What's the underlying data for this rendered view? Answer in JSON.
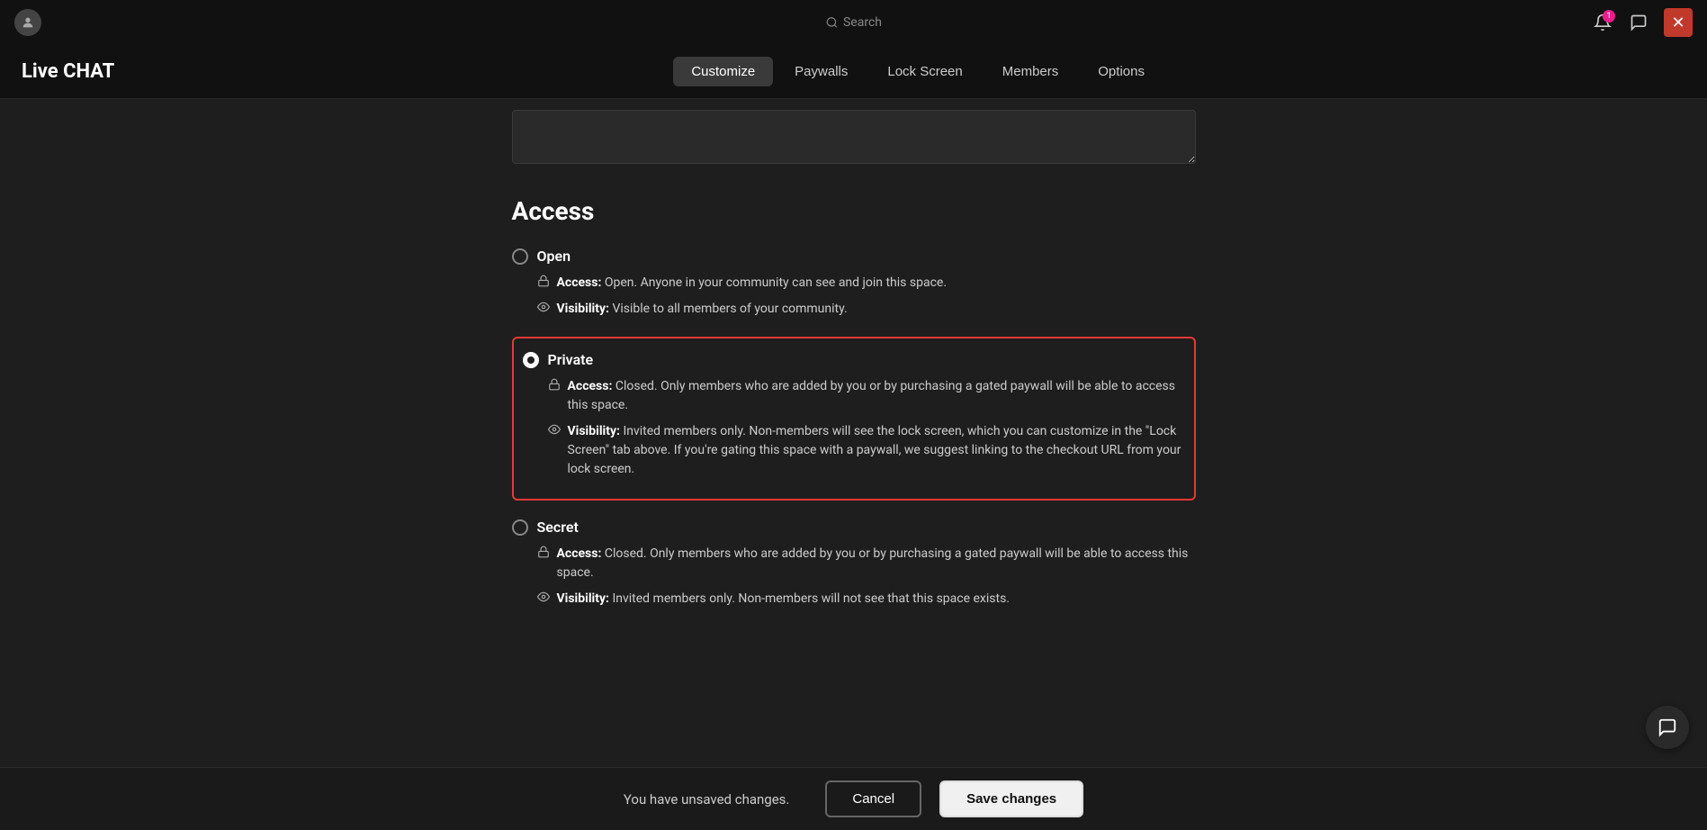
{
  "topbar": {
    "search_placeholder": "Search",
    "notification_count": "1"
  },
  "nav": {
    "brand": "Live CHAT",
    "tabs": [
      {
        "label": "Customize",
        "active": true
      },
      {
        "label": "Paywalls",
        "active": false
      },
      {
        "label": "Lock Screen",
        "active": false
      },
      {
        "label": "Members",
        "active": false
      },
      {
        "label": "Options",
        "active": false
      }
    ]
  },
  "access": {
    "title": "Access",
    "options": [
      {
        "id": "open",
        "label": "Open",
        "selected": false,
        "access_text": "Open. Anyone in your community can see and join this space.",
        "visibility_text": "Visible to all members of your community."
      },
      {
        "id": "private",
        "label": "Private",
        "selected": true,
        "access_text": "Closed. Only members who are added by you or by purchasing a gated paywall will be able to access this space.",
        "visibility_text": "Invited members only. Non-members will see the lock screen, which you can customize in the \"Lock Screen\" tab above. If you're gating this space with a paywall, we suggest linking to the checkout URL from your lock screen."
      },
      {
        "id": "secret",
        "label": "Secret",
        "selected": false,
        "access_text": "Closed. Only members who are added by you or by purchasing a gated paywall will be able to access this space.",
        "visibility_text": "Invited members only. Non-members will not see that this space exists."
      }
    ]
  },
  "footer": {
    "unsaved_text": "You have unsaved changes.",
    "cancel_label": "Cancel",
    "save_label": "Save changes"
  }
}
